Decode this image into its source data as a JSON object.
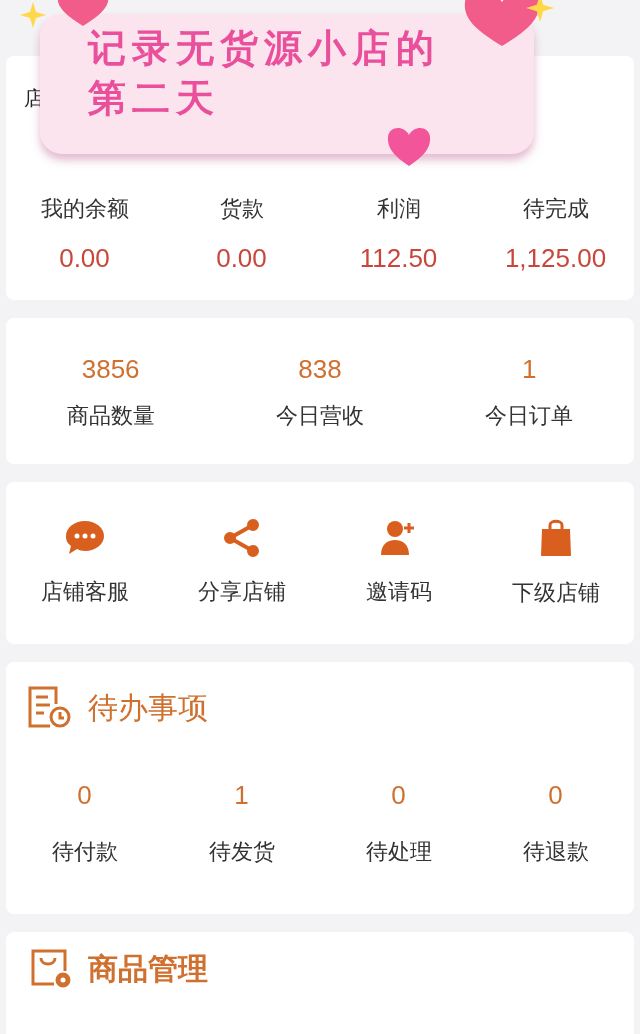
{
  "sticker": {
    "lines": [
      "记录无货源小店的",
      "第二天"
    ]
  },
  "shop_header": {
    "title": "店"
  },
  "balances": [
    {
      "label": "我的余额",
      "value": "0.00"
    },
    {
      "label": "货款",
      "value": "0.00"
    },
    {
      "label": "利润",
      "value": "112.50"
    },
    {
      "label": "待完成",
      "value": "1,125.00"
    }
  ],
  "stats": [
    {
      "value": "3856",
      "label": "商品数量"
    },
    {
      "value": "838",
      "label": "今日营收"
    },
    {
      "value": "1",
      "label": "今日订单"
    }
  ],
  "shortcuts": [
    {
      "kind": "chat",
      "label": "店铺客服"
    },
    {
      "kind": "share",
      "label": "分享店铺"
    },
    {
      "kind": "invite",
      "label": "邀请码"
    },
    {
      "kind": "bag",
      "label": "下级店铺"
    }
  ],
  "todo": {
    "title": "待办事项",
    "items": [
      {
        "value": "0",
        "label": "待付款"
      },
      {
        "value": "1",
        "label": "待发货"
      },
      {
        "value": "0",
        "label": "待处理"
      },
      {
        "value": "0",
        "label": "待退款"
      }
    ]
  },
  "goods": {
    "title": "商品管理"
  }
}
